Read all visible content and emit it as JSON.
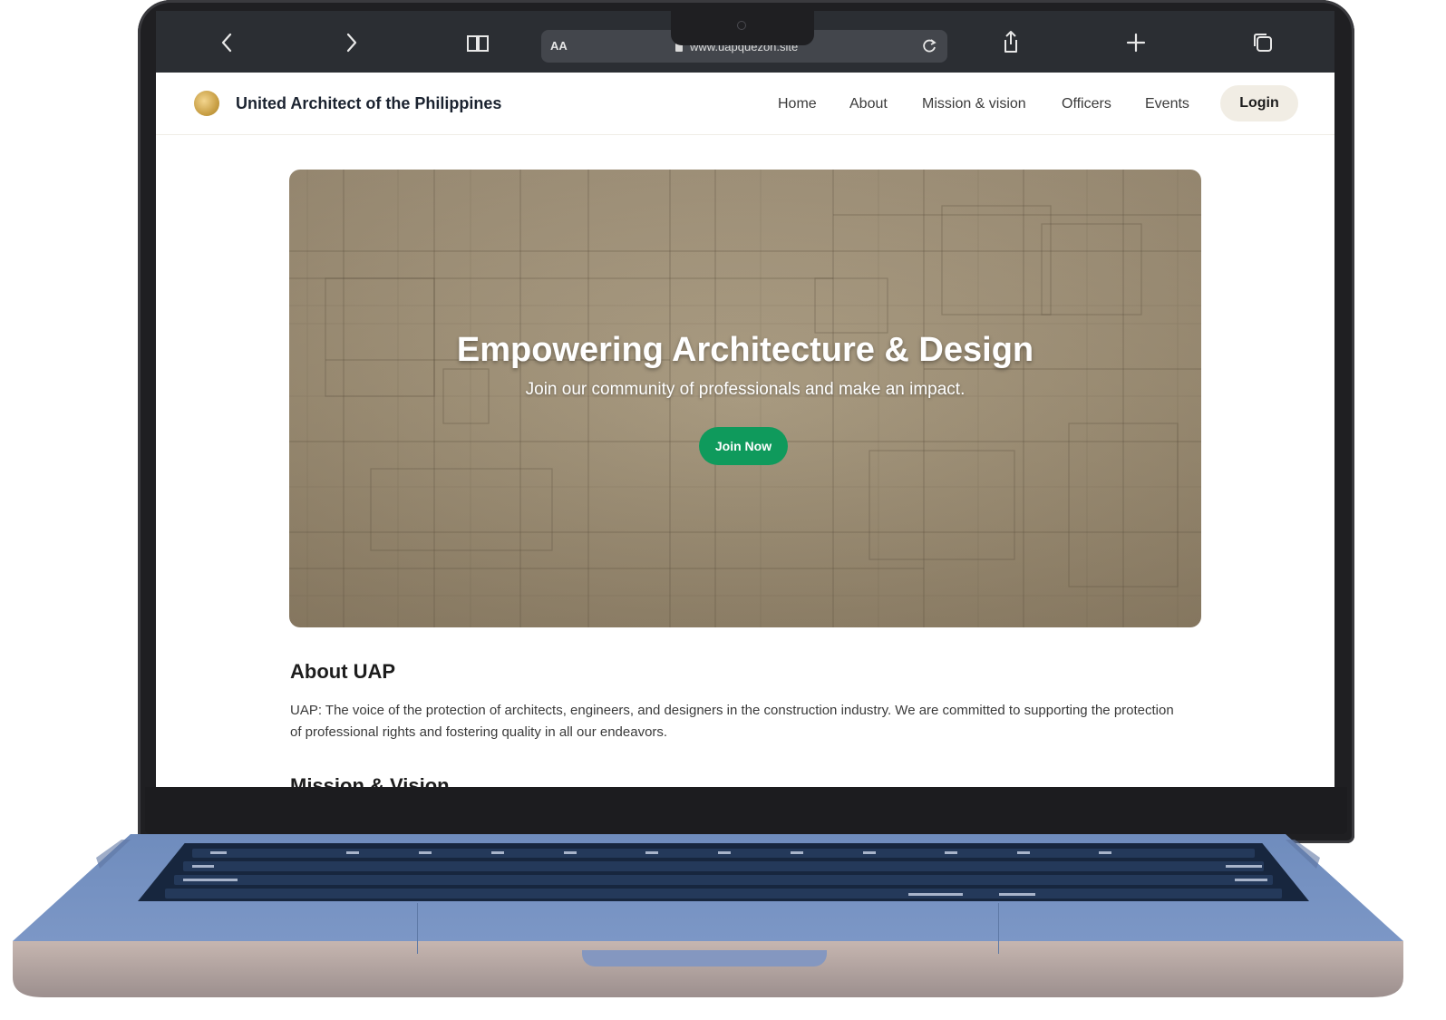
{
  "browser": {
    "reader_label": "AA",
    "url": "www.uapquezon.site"
  },
  "site": {
    "title": "United Architect of the Philippines",
    "nav": [
      "Home",
      "About",
      "Mission & vision",
      "Officers",
      "Events"
    ],
    "login_label": "Login"
  },
  "hero": {
    "title": "Empowering Architecture & Design",
    "subtitle": "Join our community of professionals and make an impact.",
    "cta_label": "Join Now"
  },
  "about": {
    "heading": "About UAP",
    "body": "UAP: The voice of the protection of architects, engineers, and designers in the construction industry. We are committed to supporting the protection of professional rights and fostering quality in all our endeavors."
  },
  "next_section": {
    "heading": "Mission & Vision"
  },
  "icons": {
    "back": "chevron-left-icon",
    "forward": "chevron-right-icon",
    "bookmarks": "book-icon",
    "reload": "reload-icon",
    "share": "share-icon",
    "new_tab": "plus-icon",
    "tabs": "tabs-icon"
  },
  "colors": {
    "cta_green": "#0f9a5c",
    "login_bg": "#f1ede4",
    "laptop_base": "#7a95c3",
    "bezel": "#1f1f22"
  }
}
